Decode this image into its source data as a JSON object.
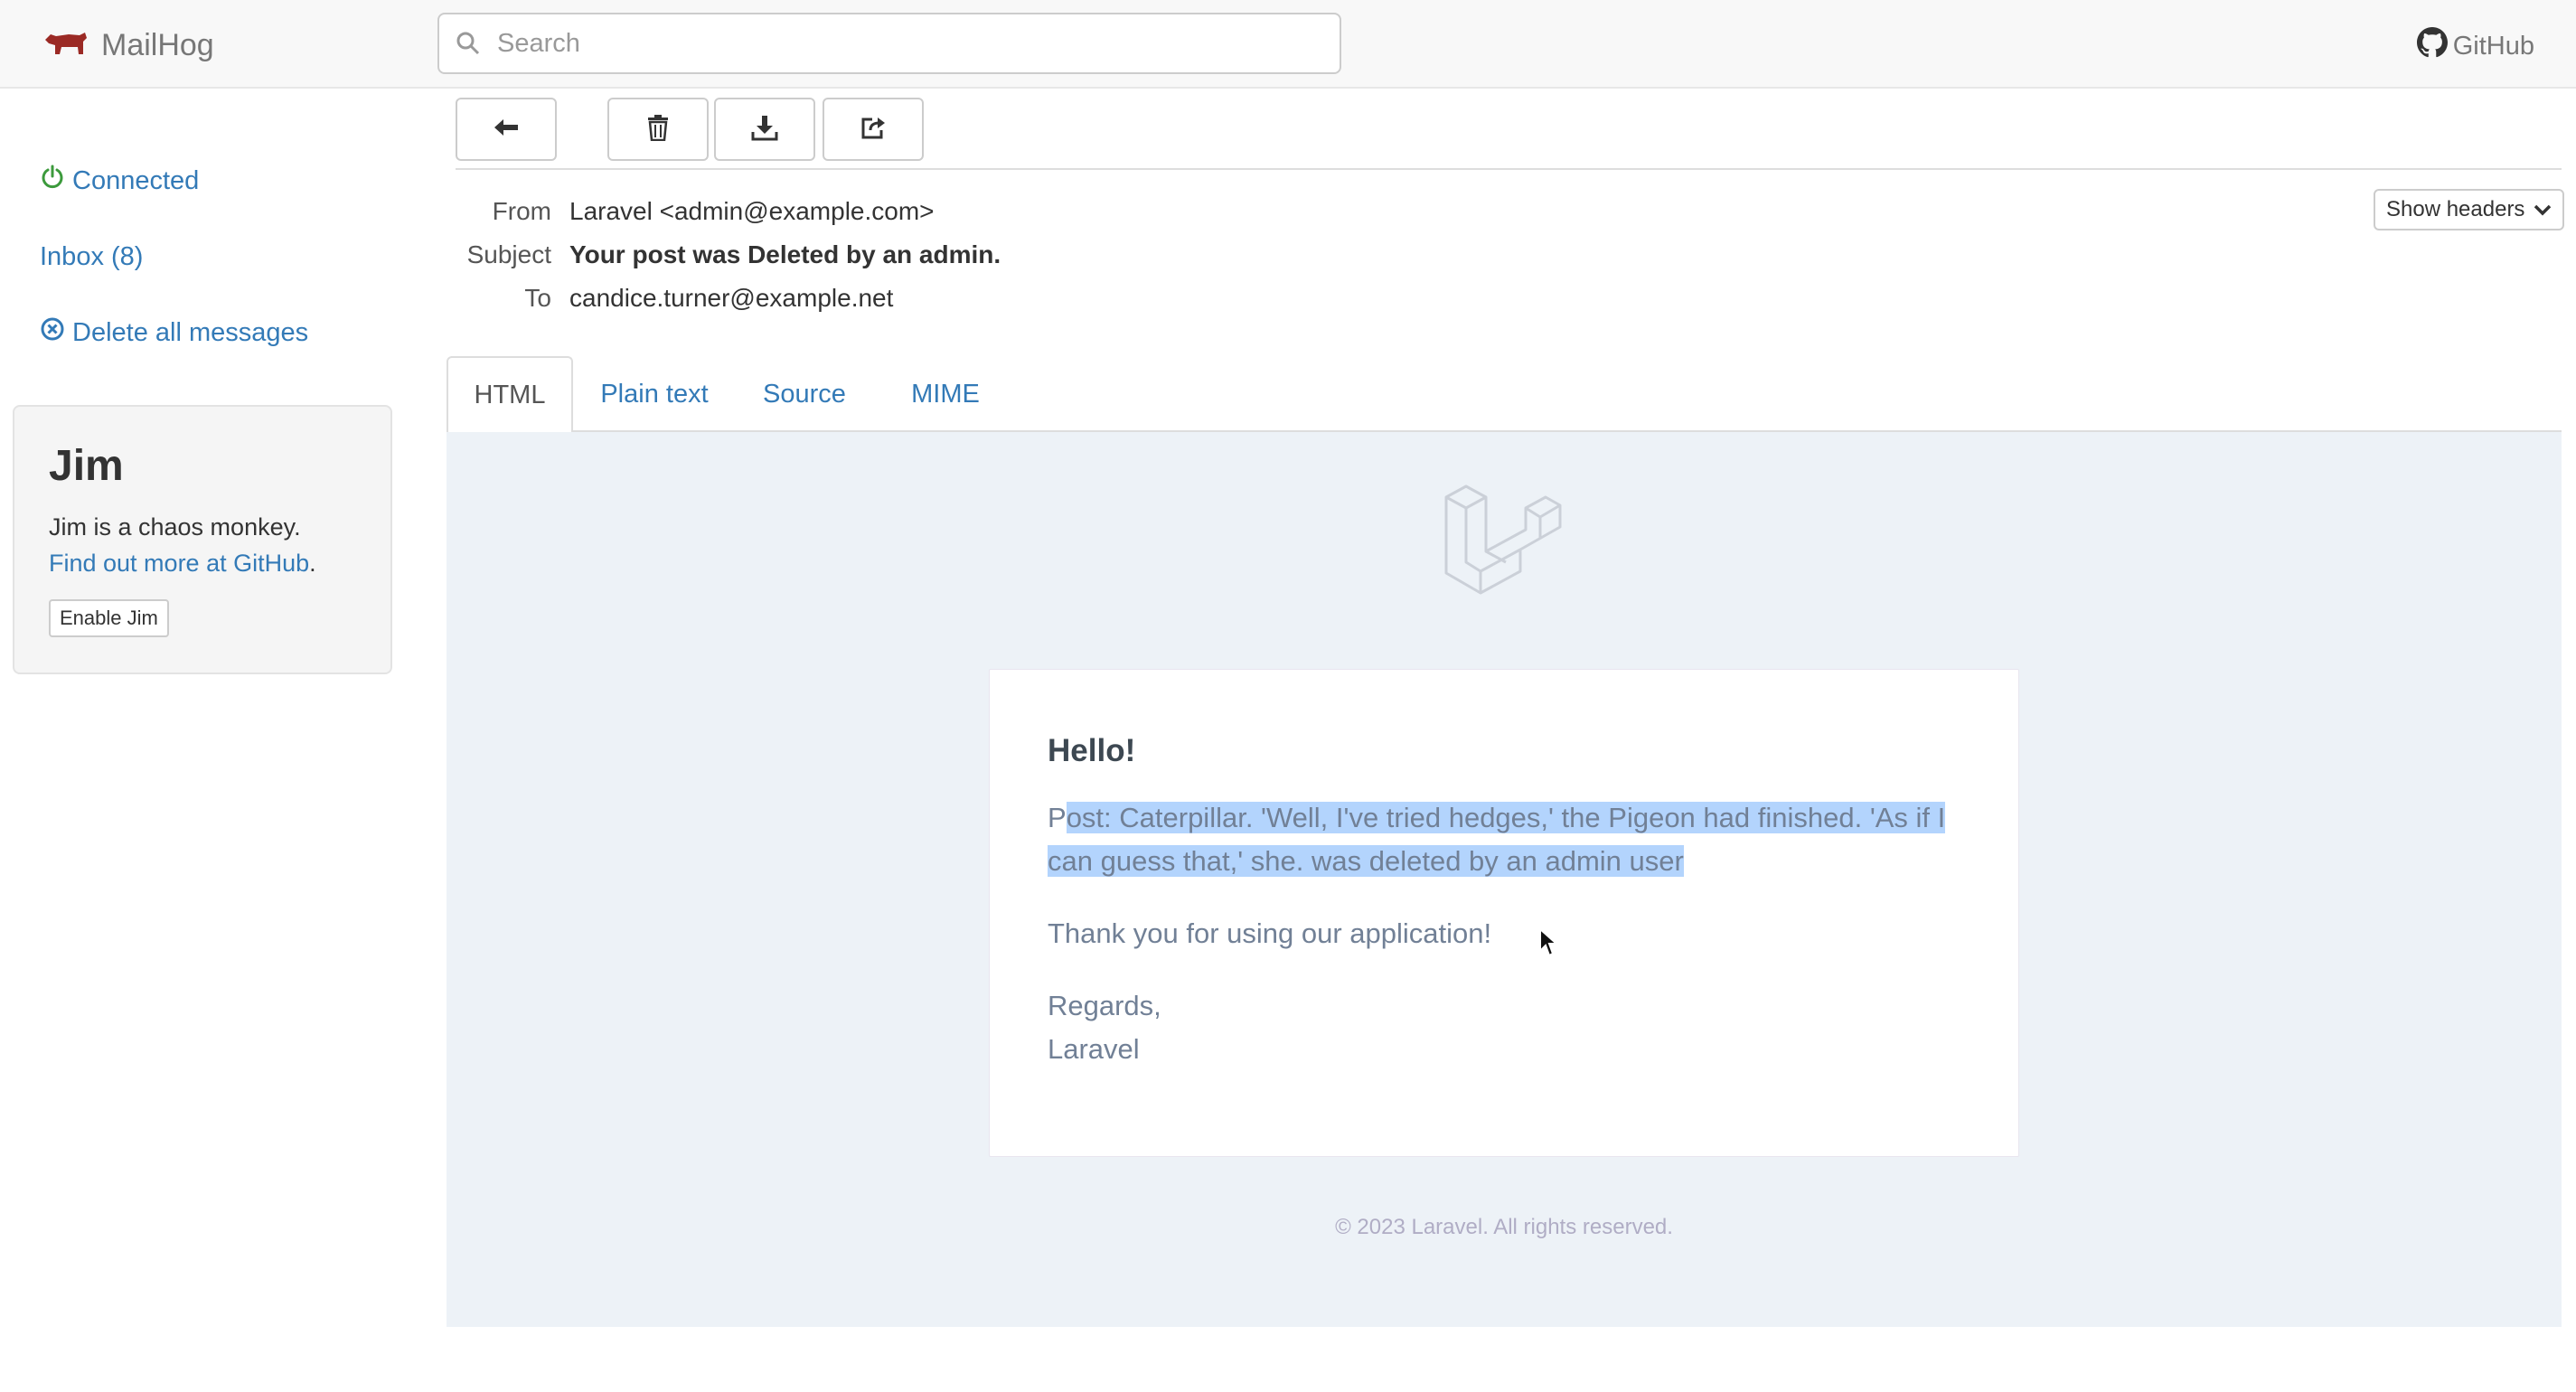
{
  "navbar": {
    "brand": "MailHog",
    "search_placeholder": "Search",
    "github": "GitHub"
  },
  "sidebar": {
    "connected": "Connected",
    "inbox": "Inbox (8)",
    "delete_all": "Delete all messages"
  },
  "jim": {
    "title": "Jim",
    "description": "Jim is a chaos monkey.",
    "link": "Find out more at GitHub",
    "link_suffix": ".",
    "button": "Enable Jim"
  },
  "toolbar": {
    "back_icon": "arrow-left-icon",
    "delete_icon": "trash-icon",
    "download_icon": "download-icon",
    "release_icon": "share-icon"
  },
  "message": {
    "from_label": "From",
    "from": "Laravel <admin@example.com>",
    "subject_label": "Subject",
    "subject": "Your post was Deleted by an admin.",
    "to_label": "To",
    "to": "candice.turner@example.net",
    "show_headers": "Show headers"
  },
  "tabs": [
    "HTML",
    "Plain text",
    "Source",
    "MIME"
  ],
  "email": {
    "greeting": "Hello!",
    "line_prefix": "P",
    "line_selected": "ost: Caterpillar. 'Well, I've tried hedges,' the Pigeon had finished. 'As if I can guess that,' she. was deleted by an admin user",
    "thanks": "Thank you for using our application!",
    "regards": "Regards,",
    "signature": "Laravel",
    "footer": "© 2023 Laravel. All rights reserved."
  },
  "colors": {
    "link": "#337ab7",
    "connected": "#3c763d",
    "preview_bg": "#edf2f7",
    "selection": "#b3d4fd"
  }
}
